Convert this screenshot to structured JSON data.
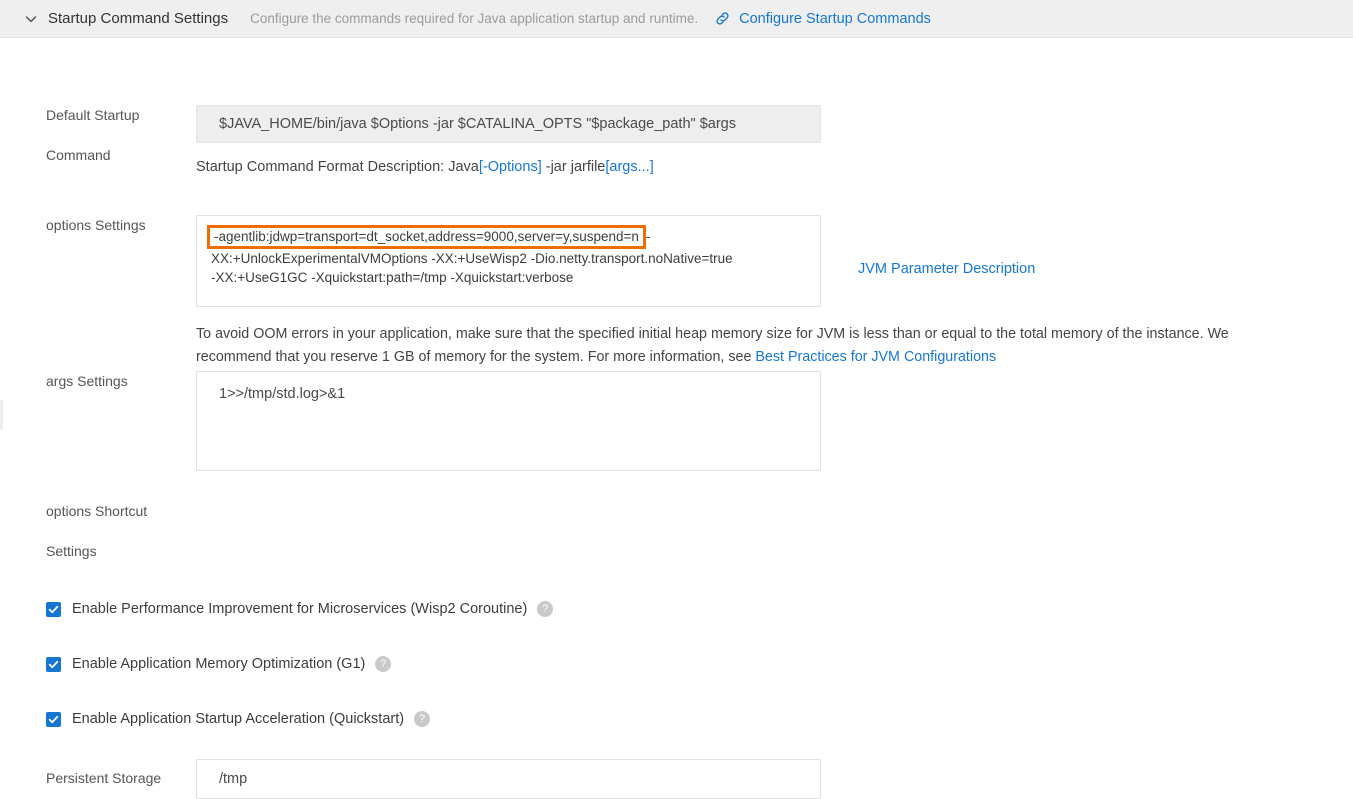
{
  "header": {
    "chevron_icon": "chevron-down-icon",
    "title": "Startup Command Settings",
    "description": "Configure the commands required for Java application startup and runtime.",
    "link_icon": "link-icon",
    "link_label": "Configure Startup Commands",
    "link_color": "#1677d2",
    "background": "#efefef"
  },
  "form": {
    "default_startup_command": {
      "label_line1": "Default Startup",
      "label_line2": "Command",
      "value": "$JAVA_HOME/bin/java $Options -jar $CATALINA_OPTS \"$package_path\" $args",
      "readonly": true,
      "format_description_prefix": "Startup Command Format Description: Java",
      "format_description_options": "[-Options]",
      "format_description_middle": " -jar jarfile",
      "format_description_args": "[args...]"
    },
    "options_settings": {
      "label": "options Settings",
      "highlighted_text": "-agentlib:jdwp=transport=dt_socket,address=9000,server=y,suspend=n",
      "highlight_color": "#ef6c00",
      "line1_tail": "-",
      "line2": "XX:+UnlockExperimentalVMOptions -XX:+UseWisp2 -Dio.netty.transport.noNative=true",
      "line3": "-XX:+UseG1GC  -Xquickstart:path=/tmp -Xquickstart:verbose",
      "side_link": "JVM Parameter Description",
      "note_part1": "To avoid OOM errors in your application, make sure that the specified initial heap memory size for JVM is less than or equal to the total memory of the instance. We recommend that you reserve 1 GB of memory for the system. For more information, see ",
      "note_link": "Best Practices for JVM Configurations"
    },
    "args_settings": {
      "label": "args Settings",
      "value": "1>>/tmp/std.log>&1"
    },
    "options_shortcut_settings": {
      "label_line1": "options Shortcut",
      "label_line2": "Settings",
      "checkboxes": [
        {
          "label": "Enable Performance Improvement for Microservices (Wisp2 Coroutine)",
          "checked": true,
          "help_icon": "help-circle-icon",
          "help_glyph": "?"
        },
        {
          "label": "Enable Application Memory Optimization (G1)",
          "checked": true,
          "help_icon": "help-circle-icon",
          "help_glyph": "?"
        },
        {
          "label": "Enable Application Startup Acceleration (Quickstart)",
          "checked": true,
          "help_icon": "help-circle-icon",
          "help_glyph": "?"
        }
      ]
    },
    "persistent_storage": {
      "label": "Persistent Storage",
      "value": "/tmp"
    }
  },
  "theme": {
    "accent": "#1677d2",
    "highlight": "#ef6c00",
    "page_background": "#ffffff",
    "readonly_background": "#eeeeee"
  }
}
